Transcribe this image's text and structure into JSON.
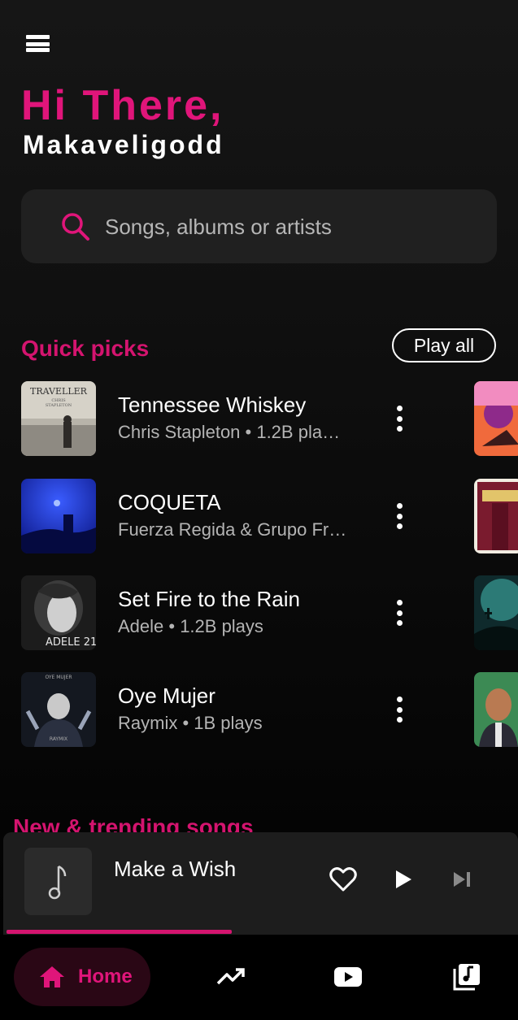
{
  "header": {
    "greeting": "Hi There,",
    "username": "Makaveligodd",
    "menu_icon": "hamburger-menu-icon"
  },
  "search": {
    "placeholder": "Songs, albums or artists",
    "value": "",
    "icon": "search-icon"
  },
  "quick_picks": {
    "title": "Quick picks",
    "play_all_label": "Play all",
    "songs": [
      {
        "title": "Tennessee Whiskey",
        "subtitle": "Chris Stapleton • 1.2B pla…"
      },
      {
        "title": "COQUETA",
        "subtitle": "Fuerza Regida & Grupo Fr…"
      },
      {
        "title": "Set Fire to the Rain",
        "subtitle": "Adele • 1.2B plays"
      },
      {
        "title": "Oye Mujer",
        "subtitle": "Raymix • 1B plays"
      }
    ]
  },
  "next_section": {
    "title": "New & trending songs"
  },
  "mini_player": {
    "title": "Make a Wish",
    "progress": 0.44,
    "icons": [
      "music-note-icon",
      "heart-icon",
      "play-icon",
      "skip-next-icon"
    ]
  },
  "bottom_nav": {
    "home_label": "Home",
    "items": [
      "home-icon",
      "trending-icon",
      "video-icon",
      "library-icon"
    ]
  },
  "colors": {
    "accent": "#e0157a",
    "background": "#121212",
    "surface": "#202020",
    "secondary_text": "#b4b4b4"
  }
}
